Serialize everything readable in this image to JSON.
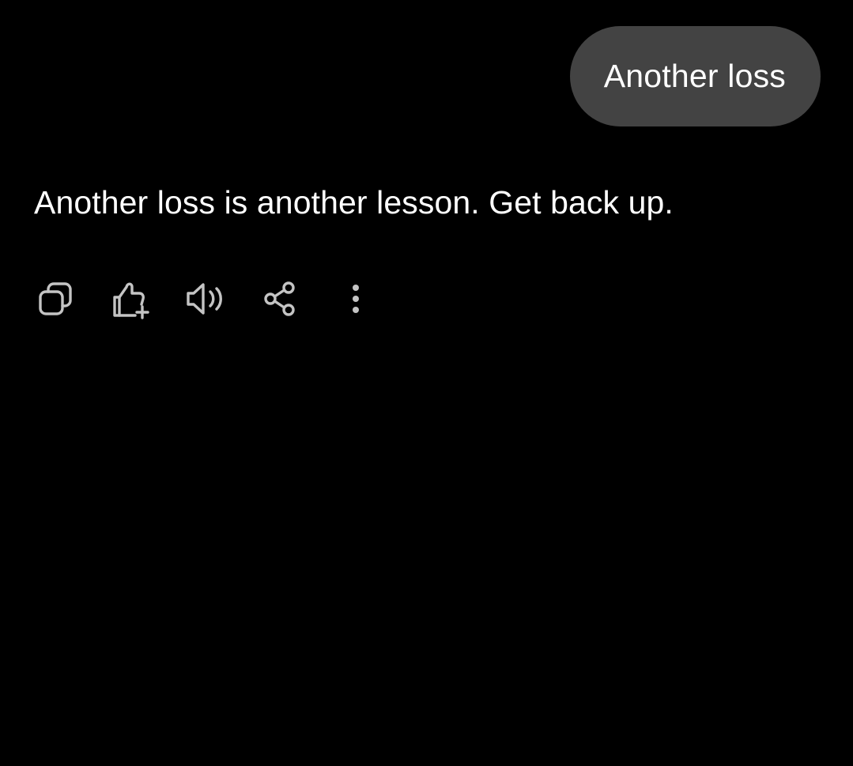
{
  "colors": {
    "background": "#000000",
    "user_bubble": "#434343",
    "text": "#ffffff",
    "icon": "#c4c4c4"
  },
  "conversation": {
    "user_message": "Another loss",
    "assistant_reply": "Another loss is another lesson. Get back up."
  },
  "actions": [
    {
      "icon": "copy-icon"
    },
    {
      "icon": "thumbs-up-add-icon"
    },
    {
      "icon": "speaker-icon"
    },
    {
      "icon": "share-icon"
    },
    {
      "icon": "more-vertical-icon"
    }
  ]
}
